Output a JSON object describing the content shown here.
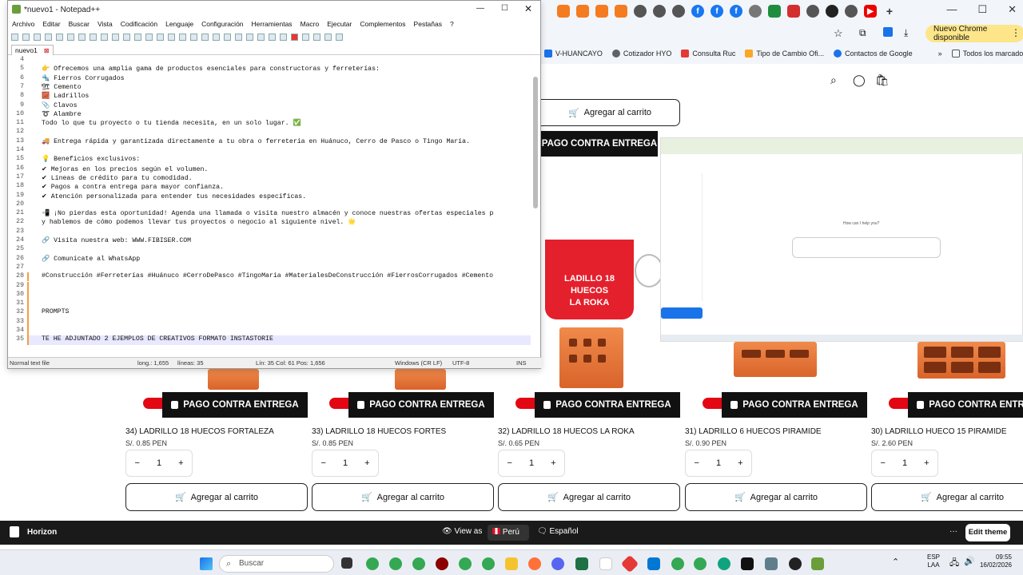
{
  "browser": {
    "update_label": "Nuevo Chrome disponible",
    "bookmarks": [
      {
        "label": "V-HUANCAYO",
        "color": "#1a73e8"
      },
      {
        "label": "Cotizador HYO",
        "color": "#5f6368"
      },
      {
        "label": "Consulta Ruc",
        "color": "#e53935"
      },
      {
        "label": "Tipo de Cambio Ofi...",
        "color": "#f9a825"
      },
      {
        "label": "Contactos de Google",
        "color": "#1a73e8"
      }
    ],
    "all_bookmarks": "Todos los marcadores",
    "overflow": "»"
  },
  "site": {
    "add_to_cart": "Agregar al carrito",
    "cash_on_delivery": "PAGO CONTRA ENTREGA",
    "promo_text": [
      "LADILLO 18",
      "HUECOS",
      "LA ROKA"
    ],
    "products": [
      {
        "name": "34) LADRILLO 18 HUECOS FORTALEZA",
        "price": "S/. 0.85 PEN",
        "qty": "1"
      },
      {
        "name": "33) LADRILLO 18 HUECOS FORTES",
        "price": "S/. 0.85 PEN",
        "qty": "1"
      },
      {
        "name": "32) LADRILLO 18 HUECOS LA ROKA",
        "price": "S/. 0.65 PEN",
        "qty": "1"
      },
      {
        "name": "31) LADRILLO 6 HUECOS PIRAMIDE",
        "price": "S/. 0.90 PEN",
        "qty": "1"
      },
      {
        "name": "30) LADRILLO HUECO 15 PIRAMIDE",
        "price": "S/. 2.60 PEN",
        "qty": "1"
      }
    ],
    "minus": "−",
    "plus": "+"
  },
  "embedded": {
    "prompt": "How can I help you?"
  },
  "notepad": {
    "title": "*nuevo1 - Notepad++",
    "menu": [
      "Archivo",
      "Editar",
      "Buscar",
      "Vista",
      "Codificación",
      "Lenguaje",
      "Configuración",
      "Herramientas",
      "Macro",
      "Ejecutar",
      "Complementos",
      "Pestañas",
      "?"
    ],
    "tab": "nuevo1",
    "lines": [
      {
        "n": "4",
        "t": ""
      },
      {
        "n": "5",
        "t": "👉 Ofrecemos una amplia gama de productos esenciales para constructoras y ferreterías:"
      },
      {
        "n": "6",
        "t": "🔩 Fierros Corrugados"
      },
      {
        "n": "7",
        "t": "🏗 Cemento"
      },
      {
        "n": "8",
        "t": "🧱 Ladrillos"
      },
      {
        "n": "9",
        "t": "📎 Clavos"
      },
      {
        "n": "10",
        "t": "➰ Alambre"
      },
      {
        "n": "11",
        "t": "Todo lo que tu proyecto o tu tienda necesita, en un solo lugar. ✅"
      },
      {
        "n": "12",
        "t": ""
      },
      {
        "n": "13",
        "t": "🚚 Entrega rápida y garantizada directamente a tu obra o ferretería en Huánuco, Cerro de Pasco o Tingo María."
      },
      {
        "n": "14",
        "t": ""
      },
      {
        "n": "15",
        "t": "💡 Beneficios exclusivos:"
      },
      {
        "n": "16",
        "t": "✔ Mejoras en los precios según el volumen."
      },
      {
        "n": "17",
        "t": "✔ Líneas de crédito para tu comodidad."
      },
      {
        "n": "18",
        "t": "✔ Pagos a contra entrega para mayor confianza."
      },
      {
        "n": "19",
        "t": "✔ Atención personalizada para entender tus necesidades específicas."
      },
      {
        "n": "20",
        "t": ""
      },
      {
        "n": "21",
        "t": "📲 ¡No pierdas esta oportunidad! Agenda una llamada o visita nuestro almacén y conoce nuestras ofertas especiales p"
      },
      {
        "n": "22",
        "t": " y hablemos de cómo podemos llevar tus proyectos o negocio al siguiente nivel. 🌟"
      },
      {
        "n": "23",
        "t": ""
      },
      {
        "n": "24",
        "t": "🔗 Visita nuestra web: WWW.FIBISER.COM"
      },
      {
        "n": "25",
        "t": ""
      },
      {
        "n": "26",
        "t": "🔗 Comunícate al WhatsApp"
      },
      {
        "n": "27",
        "t": ""
      },
      {
        "n": "28",
        "t": "#Construcción #Ferreterías #Huánuco #CerroDePasco #TingoMaría #MaterialesDeConstrucción #FierrosCorrugados #Cemento"
      },
      {
        "n": "29",
        "t": ""
      },
      {
        "n": "30",
        "t": ""
      },
      {
        "n": "31",
        "t": ""
      },
      {
        "n": "32",
        "t": "PROMPTS"
      },
      {
        "n": "33",
        "t": ""
      },
      {
        "n": "34",
        "t": ""
      },
      {
        "n": "35",
        "t": "TE HE ADJUNTADO 2 EJEMPLOS DE CREATIVOS FORMATO INSTASTORIE"
      }
    ],
    "status": {
      "type": "Normal text file",
      "length": "long.: 1,655",
      "lines": "líneas: 35",
      "pos": "Lín: 35   Col: 61   Pos: 1,656",
      "eol": "Windows (CR LF)",
      "enc": "UTF-8",
      "ins": "INS"
    }
  },
  "horizon": {
    "app": "Horizon",
    "view_as": "View as",
    "country": "Perú",
    "language": "Español",
    "edit_theme": "Edit theme",
    "more": "···"
  },
  "taskbar": {
    "search": "Buscar",
    "lang_top": "ESP",
    "lang_bottom": "LAA",
    "time": "09:55",
    "date": "16/02/2026"
  }
}
